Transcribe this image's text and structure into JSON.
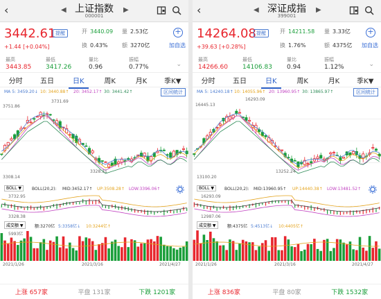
{
  "panels": [
    {
      "title": "上证指数",
      "code": "000001",
      "price": "3442.61",
      "remind": "提醒",
      "change": "+1.44",
      "change_pct": "[+0.04%]",
      "open_lbl": "开",
      "open": "3440.09",
      "vol_lbl": "量",
      "vol": "2.53亿",
      "turn_lbl": "换",
      "turn": "0.43%",
      "amt_lbl": "额",
      "amt": "3270亿",
      "add_label": "加自选",
      "high_lbl": "最高",
      "high": "3443.85",
      "low_lbl": "最低",
      "low": "3417.26",
      "ratio_lbl": "量比",
      "ratio": "0.96",
      "amp_lbl": "振幅",
      "amp": "0.77%",
      "tabs": [
        "分时",
        "五日",
        "日K",
        "周K",
        "月K",
        "季K▼"
      ],
      "ma": {
        "ma5": "MA 5: 3459.20↓",
        "ma10": "10: 3440.88↑",
        "ma20": "20: 3452.17↑",
        "ma30": "30: 3441.42↑"
      },
      "stat_btn": "区间统计",
      "chart_top": "3751.86",
      "chart_high": "3731.69",
      "chart_low": "3328.31",
      "chart_bottom": "3308.14",
      "boll_btn": "BOLL ▼",
      "boll": "BOLL(20,2):",
      "boll_mid": "MID:3452.17↑",
      "boll_up": "UP:3508.28↑",
      "boll_low": "LOW:3396.06↑",
      "boll_top": "3732.95",
      "boll_bot": "3328.38",
      "vol_btn": "成交额 ▼",
      "vol_amt": "额:3270亿",
      "vol_5": "5:3358亿↓",
      "vol_10": "10:3244亿↑",
      "vol_max": "5993亿",
      "date_start": "2021/1/26",
      "date_mid": "2021/3/16",
      "date_end": "2021/4/27",
      "up_lbl": "上涨",
      "up": "657家",
      "flat_lbl": "平盘",
      "flat": "131家",
      "down_lbl": "下跌",
      "down": "1201家"
    },
    {
      "title": "深证成指",
      "code": "399001",
      "price": "14264.08",
      "remind": "提醒",
      "change": "+39.63",
      "change_pct": "[+0.28%]",
      "open_lbl": "开",
      "open": "14211.58",
      "vol_lbl": "量",
      "vol": "3.33亿",
      "turn_lbl": "换",
      "turn": "1.76%",
      "amt_lbl": "额",
      "amt": "4375亿",
      "add_label": "加自选",
      "high_lbl": "最高",
      "high": "14266.60",
      "low_lbl": "最低",
      "low": "14106.83",
      "ratio_lbl": "量比",
      "ratio": "0.94",
      "amp_lbl": "振幅",
      "amp": "1.12%",
      "tabs": [
        "分时",
        "五日",
        "日K",
        "周K",
        "月K",
        "季K▼"
      ],
      "ma": {
        "ma5": "MA 5: 14240.18↑",
        "ma10": "10: 14055.96↑",
        "ma20": "20: 13960.95↑",
        "ma30": "30: 13865.97↑"
      },
      "stat_btn": "区间统计",
      "chart_top": "16445.13",
      "chart_high": "16293.09",
      "chart_low": "13252.24",
      "chart_bottom": "13100.20",
      "boll_btn": "BOLL ▼",
      "boll": "BOLL(20,2):",
      "boll_mid": "MID:13960.95↑",
      "boll_up": "UP:14440.38↑",
      "boll_low": "LOW:13481.52↑",
      "boll_top": "16293.09",
      "boll_bot": "12987.06",
      "vol_btn": "成交额 ▼",
      "vol_amt": "额:4375亿",
      "vol_5": "5:4513亿↓",
      "vol_10": "10:4405亿↑",
      "vol_max": "",
      "date_start": "2021/1/26",
      "date_mid": "2021/3/16",
      "date_end": "2021/4/27",
      "up_lbl": "上涨",
      "up": "836家",
      "flat_lbl": "平盘",
      "flat": "80家",
      "down_lbl": "下跌",
      "down": "1532家"
    }
  ],
  "colors": {
    "up": "#e8262e",
    "down": "#1a9e3a",
    "accent": "#2f62c9",
    "ma5": "#4a7bd0",
    "ma10": "#e3a21a",
    "ma20": "#c040c0",
    "ma30": "#2e8b57"
  }
}
